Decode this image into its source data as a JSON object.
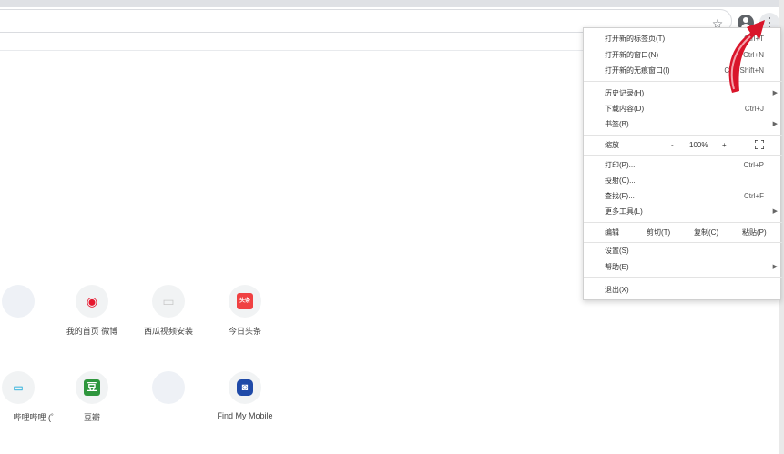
{
  "toolbar": {
    "star_icon": "star-icon",
    "profile_icon": "profile-icon",
    "menu_icon": "more-vert-icon"
  },
  "shortcuts": [
    {
      "label": "",
      "color": "#dfe6f3",
      "glyph": ""
    },
    {
      "label": "我的首页 微博",
      "color": "#e6162d",
      "glyph": "◉"
    },
    {
      "label": "西瓜视频安装",
      "color": "#d9d9d9",
      "glyph": "▭"
    },
    {
      "label": "今日头条",
      "color": "#f04142",
      "glyph": "头条"
    },
    {
      "label": "哔哩哔哩 (゜",
      "color": "#00a1d6",
      "glyph": "📺"
    },
    {
      "label": "豆瓣",
      "color": "#2e963d",
      "glyph": "豆"
    },
    {
      "label": "",
      "color": "#dfe6f3",
      "glyph": ""
    },
    {
      "label": "Find My Mobile",
      "color": "#1f4aa8",
      "glyph": "◙"
    }
  ],
  "menu": {
    "new_tab": {
      "label": "打开新的标签页(T)",
      "shortcut": "Ctrl+T"
    },
    "new_window": {
      "label": "打开新的窗口(N)",
      "shortcut": "Ctrl+N"
    },
    "incognito": {
      "label": "打开新的无痕窗口(I)",
      "shortcut": "Ctrl+Shift+N"
    },
    "history": {
      "label": "历史记录(H)"
    },
    "downloads": {
      "label": "下载内容(D)",
      "shortcut": "Ctrl+J"
    },
    "bookmarks": {
      "label": "书签(B)"
    },
    "zoom": {
      "label": "缩放",
      "minus": "-",
      "value": "100%",
      "plus": "+"
    },
    "print": {
      "label": "打印(P)...",
      "shortcut": "Ctrl+P"
    },
    "cast": {
      "label": "投射(C)..."
    },
    "find": {
      "label": "查找(F)...",
      "shortcut": "Ctrl+F"
    },
    "more_tools": {
      "label": "更多工具(L)"
    },
    "edit": {
      "label": "编辑",
      "cut": "剪切(T)",
      "copy": "复制(C)",
      "paste": "粘贴(P)"
    },
    "settings": {
      "label": "设置(S)"
    },
    "help": {
      "label": "帮助(E)"
    },
    "exit": {
      "label": "退出(X)"
    }
  },
  "colors": {
    "arrow": "#d9152a",
    "menu_border": "#d0d0d0"
  }
}
